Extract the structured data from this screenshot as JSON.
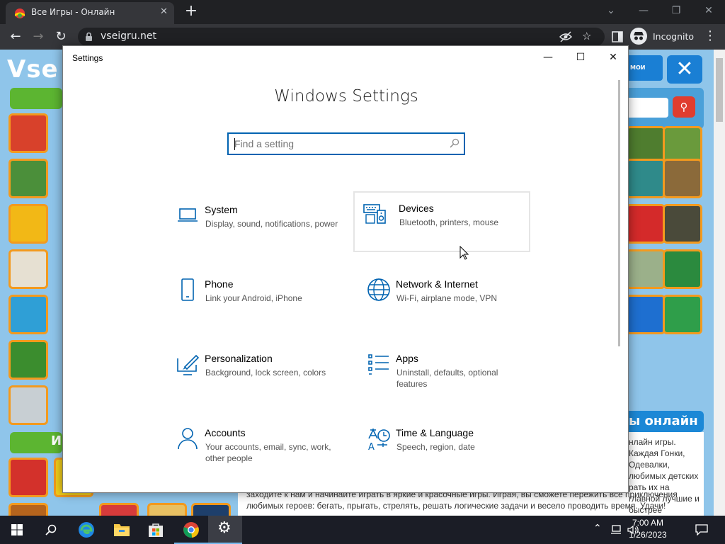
{
  "browser": {
    "tab_title": "Все Игры - Онлайн",
    "url": "vseigru.net",
    "incognito_label": "Incognito"
  },
  "web": {
    "logo": "Vse",
    "top_button": "МОИ ИГРЫ",
    "section_heading": "ы онлайн",
    "section_short": "И",
    "article_right": "нлайн игры. Каждая Гонки, Одевалки, любимых детских рать их на главной лучшие и быстрее",
    "article_text": "заходите к нам и начинайте играть в яркие и красочные игры. Играя, вы сможете пережить все приключения любимых героев: бегать, прыгать, стрелять, решать логические задачи и весело проводить время. Удачи!"
  },
  "settings": {
    "window_title": "Settings",
    "heading": "Windows Settings",
    "search_placeholder": "Find a setting",
    "tiles": [
      {
        "name": "System",
        "desc": "Display, sound, notifications, power",
        "icon": "laptop-icon"
      },
      {
        "name": "Devices",
        "desc": "Bluetooth, printers, mouse",
        "icon": "keyboard-speaker-icon"
      },
      {
        "name": "Phone",
        "desc": "Link your Android, iPhone",
        "icon": "phone-icon"
      },
      {
        "name": "Network & Internet",
        "desc": "Wi-Fi, airplane mode, VPN",
        "icon": "globe-icon"
      },
      {
        "name": "Personalization",
        "desc": "Background, lock screen, colors",
        "icon": "paint-tablet-icon"
      },
      {
        "name": "Apps",
        "desc": "Uninstall, defaults, optional features",
        "icon": "apps-list-icon"
      },
      {
        "name": "Accounts",
        "desc": "Your accounts, email, sync, work, other people",
        "icon": "person-icon"
      },
      {
        "name": "Time & Language",
        "desc": "Speech, region, date",
        "icon": "time-language-icon"
      }
    ]
  },
  "taskbar": {
    "time": "7:00 AM",
    "date": "1/26/2023"
  },
  "colors": {
    "accent": "#0063b1",
    "chrome_bg": "#202124",
    "taskbar_bg": "#1b1d26",
    "site_bg": "#8fc5ea",
    "thumb_border": "#f39a1e"
  }
}
